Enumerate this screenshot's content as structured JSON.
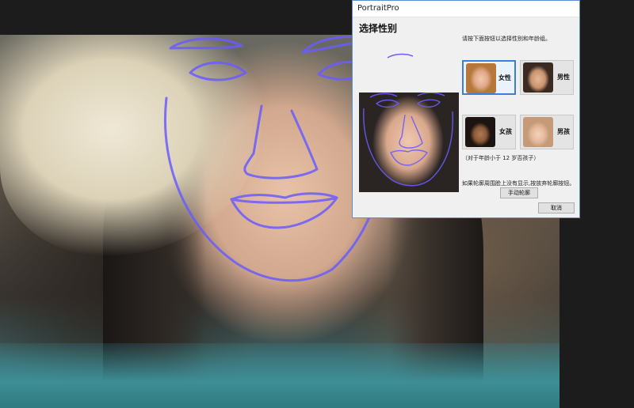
{
  "dialog": {
    "title": "PortraitPro",
    "heading": "选择性别",
    "instruction": "请按下面按钮以选择性别和年龄组。",
    "age_note": "（对于年龄小于 12 岁否孩子）",
    "hint": "如果轮廓周围脸上没有显示,按放弃轮廓按钮。",
    "manual_label": "手动轮廓",
    "cancel_label": "取消",
    "options": [
      {
        "label": "女性",
        "selected": true
      },
      {
        "label": "男性",
        "selected": false
      },
      {
        "label": "女孩",
        "selected": false
      },
      {
        "label": "男孩",
        "selected": false
      }
    ]
  },
  "colors": {
    "accent": "#3b7fd8",
    "outline": "#6a5cff"
  }
}
